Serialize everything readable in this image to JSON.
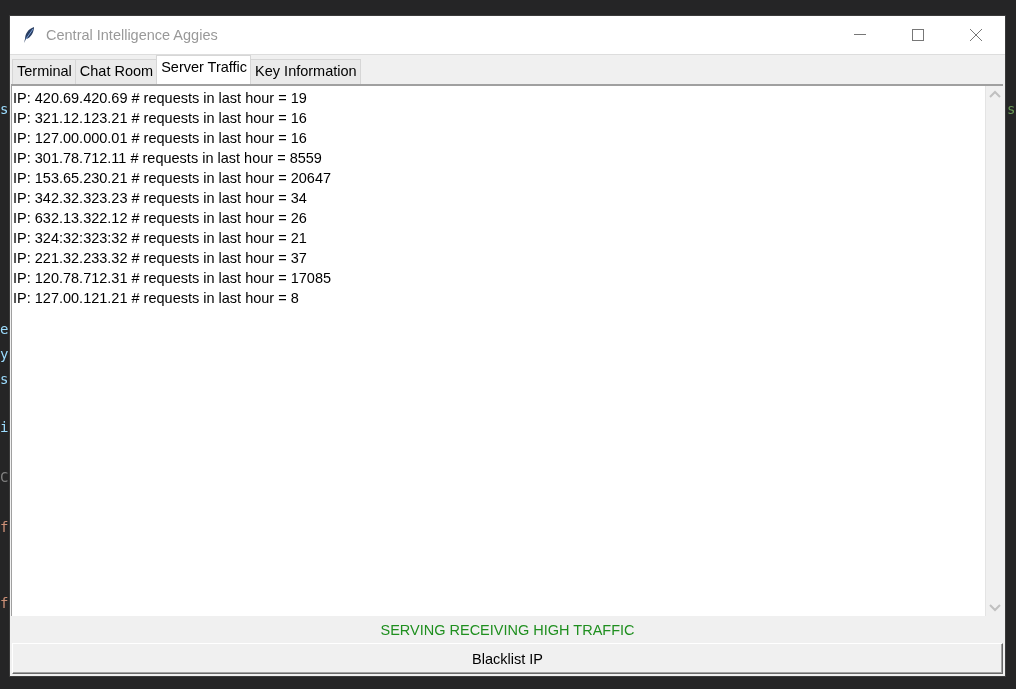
{
  "editor_fragments": [
    "s",
    "s",
    "e",
    "y",
    "s",
    "i",
    "C",
    "f",
    "f"
  ],
  "window": {
    "title": "Central Intelligence Aggies"
  },
  "tabs": [
    {
      "label": "Terminal",
      "selected": false
    },
    {
      "label": "Chat Room",
      "selected": false
    },
    {
      "label": "Server Traffic",
      "selected": true
    },
    {
      "label": "Key Information",
      "selected": false
    }
  ],
  "traffic_lines": [
    "IP: 420.69.420.69 # requests in last hour = 19",
    "IP: 321.12.123.21 # requests in last hour = 16",
    "IP: 127.00.000.01 # requests in last hour = 16",
    "IP: 301.78.712.11 # requests in last hour = 8559",
    "IP: 153.65.230.21 # requests in last hour = 20647",
    "IP: 342.32.323.23 # requests in last hour = 34",
    "IP: 632.13.322.12 # requests in last hour = 26",
    "IP: 324:32:323:32 # requests in last hour = 21",
    "IP: 221.32.233.32 # requests in last hour = 37",
    "IP: 120.78.712.31 # requests in last hour = 17085",
    "IP: 127.00.121.21 # requests in last hour = 8"
  ],
  "status": {
    "text": "SERVING RECEIVING HIGH TRAFFIC"
  },
  "buttons": [
    "Blacklist IP"
  ]
}
